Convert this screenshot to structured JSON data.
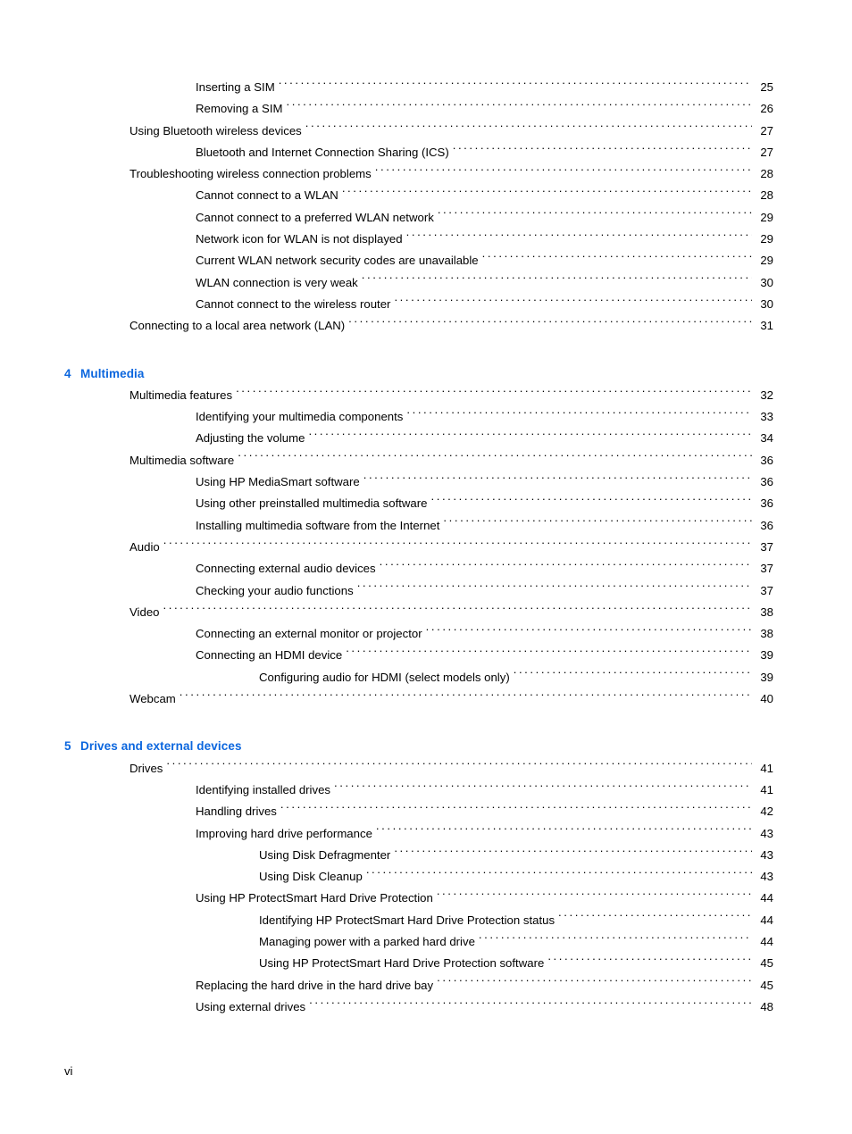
{
  "page": {
    "folio": "vi",
    "accent_color": "#0b66de",
    "text_color": "#000000",
    "background_color": "#ffffff"
  },
  "toc": {
    "blocks": [
      {
        "type": "entries",
        "entries": [
          {
            "level": 2,
            "title": "Inserting a SIM",
            "page": "25"
          },
          {
            "level": 2,
            "title": "Removing a SIM",
            "page": "26"
          },
          {
            "level": 1,
            "title": "Using Bluetooth wireless devices",
            "page": "27"
          },
          {
            "level": 2,
            "title": "Bluetooth and Internet Connection Sharing (ICS)",
            "page": "27"
          },
          {
            "level": 1,
            "title": "Troubleshooting wireless connection problems",
            "page": "28"
          },
          {
            "level": 2,
            "title": "Cannot connect to a WLAN",
            "page": "28"
          },
          {
            "level": 2,
            "title": "Cannot connect to a preferred WLAN network",
            "page": "29"
          },
          {
            "level": 2,
            "title": "Network icon for WLAN is not displayed",
            "page": "29"
          },
          {
            "level": 2,
            "title": "Current WLAN network security codes are unavailable",
            "page": "29"
          },
          {
            "level": 2,
            "title": "WLAN connection is very weak",
            "page": "30"
          },
          {
            "level": 2,
            "title": "Cannot connect to the wireless router",
            "page": "30"
          },
          {
            "level": 1,
            "title": "Connecting to a local area network (LAN)",
            "page": "31"
          }
        ]
      },
      {
        "type": "chapter",
        "number": "4",
        "title": "Multimedia",
        "entries": [
          {
            "level": 1,
            "title": "Multimedia features",
            "page": "32"
          },
          {
            "level": 2,
            "title": "Identifying your multimedia components",
            "page": "33"
          },
          {
            "level": 2,
            "title": "Adjusting the volume",
            "page": "34"
          },
          {
            "level": 1,
            "title": "Multimedia software",
            "page": "36"
          },
          {
            "level": 2,
            "title": "Using HP MediaSmart software",
            "page": "36"
          },
          {
            "level": 2,
            "title": "Using other preinstalled multimedia software",
            "page": "36"
          },
          {
            "level": 2,
            "title": "Installing multimedia software from the Internet",
            "page": "36"
          },
          {
            "level": 1,
            "title": "Audio",
            "page": "37"
          },
          {
            "level": 2,
            "title": "Connecting external audio devices",
            "page": "37"
          },
          {
            "level": 2,
            "title": "Checking your audio functions",
            "page": "37"
          },
          {
            "level": 1,
            "title": "Video",
            "page": "38"
          },
          {
            "level": 2,
            "title": "Connecting an external monitor or projector",
            "page": "38"
          },
          {
            "level": 2,
            "title": "Connecting an HDMI device",
            "page": "39"
          },
          {
            "level": 3,
            "title": "Configuring audio for HDMI (select models only)",
            "page": "39"
          },
          {
            "level": 1,
            "title": "Webcam",
            "page": "40"
          }
        ]
      },
      {
        "type": "chapter",
        "number": "5",
        "title": "Drives and external devices",
        "entries": [
          {
            "level": 1,
            "title": "Drives",
            "page": "41"
          },
          {
            "level": 2,
            "title": "Identifying installed drives",
            "page": "41"
          },
          {
            "level": 2,
            "title": "Handling drives",
            "page": "42"
          },
          {
            "level": 2,
            "title": "Improving hard drive performance",
            "page": "43"
          },
          {
            "level": 3,
            "title": "Using Disk Defragmenter",
            "page": "43"
          },
          {
            "level": 3,
            "title": "Using Disk Cleanup",
            "page": "43"
          },
          {
            "level": 2,
            "title": "Using HP ProtectSmart Hard Drive Protection",
            "page": "44"
          },
          {
            "level": 3,
            "title": "Identifying HP ProtectSmart Hard Drive Protection status",
            "page": "44"
          },
          {
            "level": 3,
            "title": "Managing power with a parked hard drive",
            "page": "44"
          },
          {
            "level": 3,
            "title": "Using HP ProtectSmart Hard Drive Protection software",
            "page": "45"
          },
          {
            "level": 2,
            "title": "Replacing the hard drive in the hard drive bay",
            "page": "45"
          },
          {
            "level": 2,
            "title": "Using external drives",
            "page": "48"
          }
        ]
      }
    ]
  }
}
